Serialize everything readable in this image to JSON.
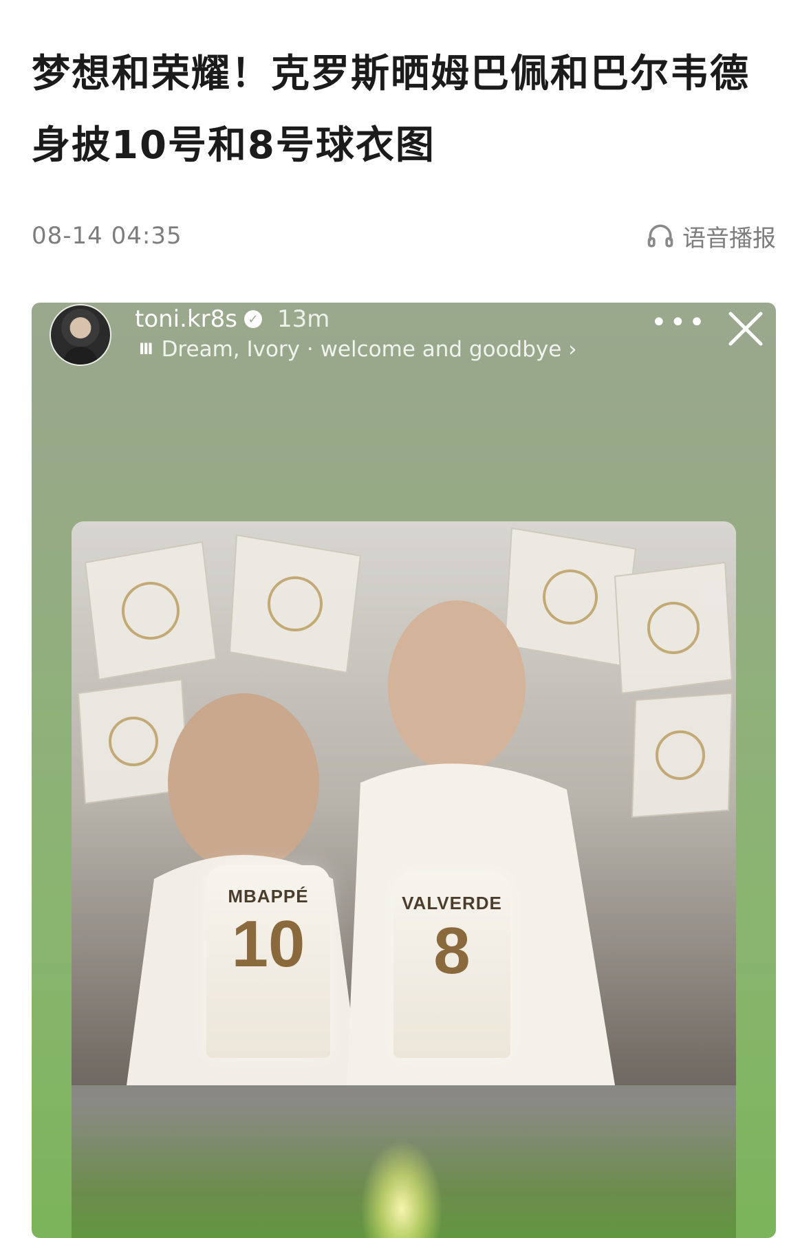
{
  "article": {
    "title": "梦想和荣耀！克罗斯晒姆巴佩和巴尔韦德身披10号和8号球衣图",
    "date": "08-14 04:35",
    "tts_label": "语音播报"
  },
  "story": {
    "username": "toni.kr8s",
    "verified_mark": "✓",
    "time_ago": "13m",
    "music_bars": "III",
    "music_text": "Dream, Ivory · welcome and goodbye ›",
    "more_label": "•••",
    "players": [
      {
        "name": "MBAPPÉ",
        "number": "10"
      },
      {
        "name": "VALVERDE",
        "number": "8"
      }
    ]
  },
  "colors": {
    "story_bg_top": "#9aa88d",
    "story_bg_bottom": "#7bb45a",
    "shirt_number": "#8a6a3c"
  }
}
